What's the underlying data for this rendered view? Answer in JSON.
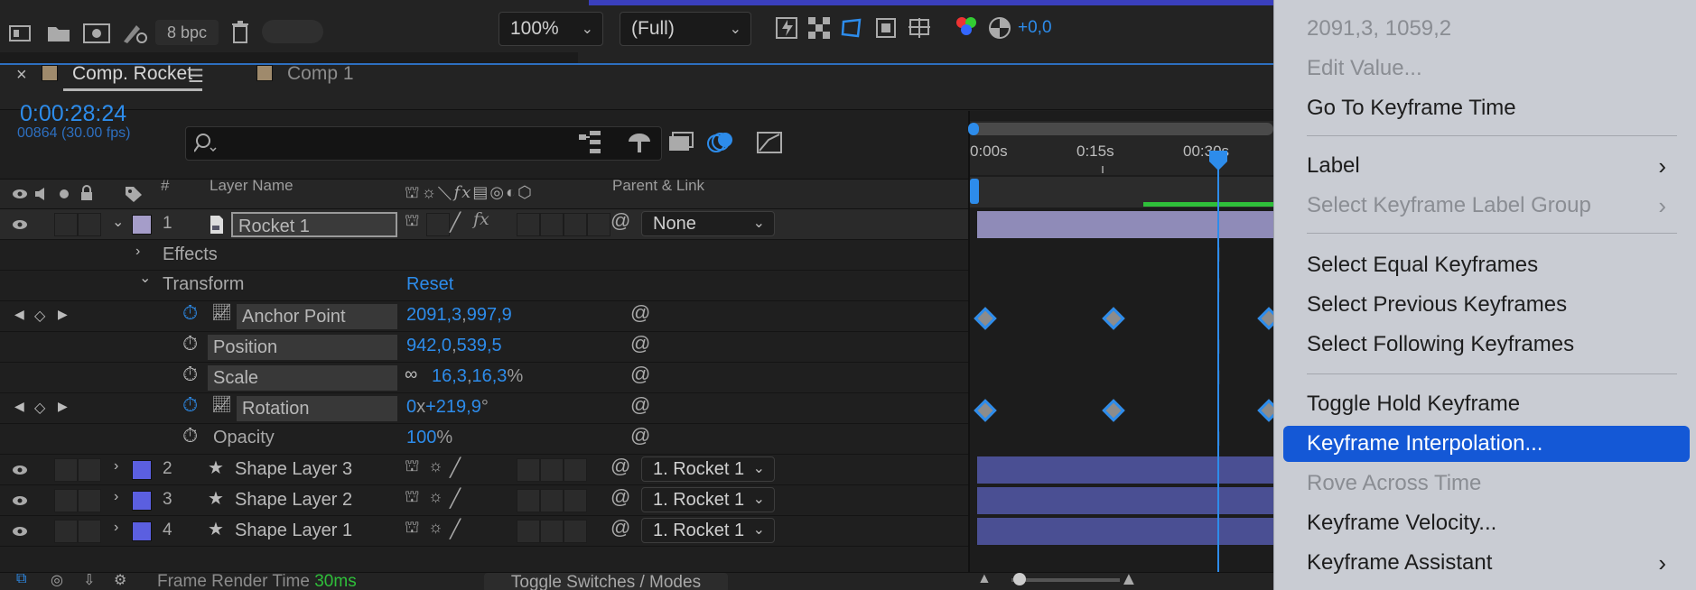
{
  "toolbar": {
    "bpc": "8 bpc",
    "zoom": "100%",
    "resolution": "(Full)",
    "exposure": "+0,0"
  },
  "comp": {
    "active_tab": "Comp. Rocket",
    "other_tab": "Comp 1",
    "timecode": "0:00:28:24",
    "frame_info": "00864 (30.00 fps)"
  },
  "columns": {
    "number": "#",
    "layer_name": "Layer Name",
    "parent_link": "Parent & Link"
  },
  "layers": [
    {
      "index": "1",
      "name": "Rocket 1",
      "parent": "None",
      "color": "#a59dc9"
    },
    {
      "index": "2",
      "name": "Shape Layer 3",
      "parent": "1. Rocket 1",
      "color": "#5b5fe0"
    },
    {
      "index": "3",
      "name": "Shape Layer 2",
      "parent": "1. Rocket 1",
      "color": "#5b5fe0"
    },
    {
      "index": "4",
      "name": "Shape Layer 1",
      "parent": "1. Rocket 1",
      "color": "#5b5fe0"
    }
  ],
  "groups": {
    "effects": "Effects",
    "transform": "Transform",
    "reset": "Reset"
  },
  "properties": {
    "anchor_point": {
      "label": "Anchor Point",
      "x": "2091,3",
      "y": "997,9"
    },
    "position": {
      "label": "Position",
      "x": "942,0",
      "y": "539,5"
    },
    "scale": {
      "label": "Scale",
      "x": "16,3",
      "y": "16,3",
      "unit": "%"
    },
    "rotation": {
      "label": "Rotation",
      "turns": "0",
      "sep": "x",
      "deg": "+219,9",
      "unit": "°"
    },
    "opacity": {
      "label": "Opacity",
      "value": "100",
      "unit": "%"
    }
  },
  "ruler": {
    "t0": "0:00s",
    "t15": "0:15s",
    "t30": "00:30s"
  },
  "bottom": {
    "render_label": "Frame Render Time",
    "render_value": "30ms",
    "toggle": "Toggle Switches / Modes"
  },
  "context_menu": {
    "value_readout": "2091,3, 1059,2",
    "items": [
      {
        "label": "Edit Value...",
        "state": "disabled"
      },
      {
        "label": "Go To Keyframe Time",
        "state": "enabled"
      },
      {
        "label": "Label",
        "state": "enabled",
        "submenu": "›"
      },
      {
        "label": "Select Keyframe Label Group",
        "state": "disabled",
        "submenu": "›"
      },
      {
        "label": "Select Equal Keyframes",
        "state": "enabled"
      },
      {
        "label": "Select Previous Keyframes",
        "state": "enabled"
      },
      {
        "label": "Select Following Keyframes",
        "state": "enabled"
      },
      {
        "label": "Toggle Hold Keyframe",
        "state": "enabled"
      },
      {
        "label": "Keyframe Interpolation...",
        "state": "selected"
      },
      {
        "label": "Rove Across Time",
        "state": "disabled"
      },
      {
        "label": "Keyframe Velocity...",
        "state": "enabled"
      },
      {
        "label": "Keyframe Assistant",
        "state": "enabled",
        "submenu": "›"
      }
    ]
  },
  "colors": {
    "accent": "#2d8ceb",
    "menu_highlight": "#1458d6",
    "green_bar": "#2fbf3a",
    "layer_bar_rocket": "#8f8bb8",
    "layer_bar_shape": "#4a4f93"
  }
}
